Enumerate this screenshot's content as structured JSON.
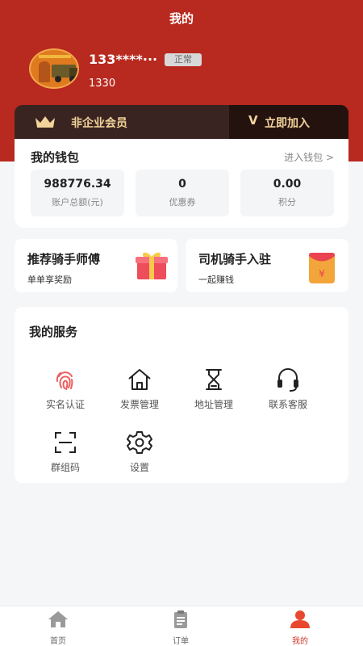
{
  "header": {
    "title": "我的"
  },
  "user": {
    "phone": "133****···",
    "status": "正常",
    "id": "1330"
  },
  "membership": {
    "status_label": "非企业会员",
    "join_label": "立即加入",
    "join_prefix": "V"
  },
  "wallet": {
    "title": "我的钱包",
    "link": "进入钱包 >",
    "items": [
      {
        "value": "988776.34",
        "label": "账户总额(元)"
      },
      {
        "value": "0",
        "label": "优惠券"
      },
      {
        "value": "0.00",
        "label": "积分"
      }
    ]
  },
  "promos": [
    {
      "title": "推荐骑手师傅",
      "subtitle": "单单享奖励",
      "icon": "gift-icon"
    },
    {
      "title": "司机骑手入驻",
      "subtitle": "一起赚钱",
      "icon": "red-envelope-icon"
    }
  ],
  "services": {
    "title": "我的服务",
    "items": [
      {
        "label": "实名认证",
        "icon": "fingerprint-icon"
      },
      {
        "label": "发票管理",
        "icon": "home-icon"
      },
      {
        "label": "地址管理",
        "icon": "hourglass-icon"
      },
      {
        "label": "联系客服",
        "icon": "headset-icon"
      },
      {
        "label": "群组码",
        "icon": "scan-icon"
      },
      {
        "label": "设置",
        "icon": "gear-icon"
      }
    ]
  },
  "tabbar": {
    "items": [
      {
        "label": "首页",
        "icon": "home-icon"
      },
      {
        "label": "订单",
        "icon": "clipboard-icon"
      },
      {
        "label": "我的",
        "icon": "user-icon"
      }
    ],
    "active_index": 2
  },
  "colors": {
    "brand_red": "#b8291f",
    "gold": "#f3d49a",
    "active_tab": "#d03a2a"
  }
}
